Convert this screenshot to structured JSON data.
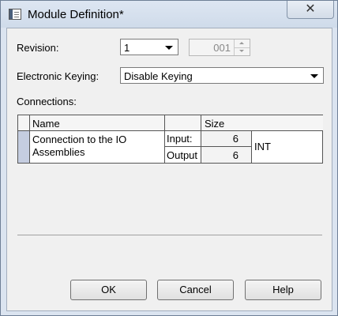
{
  "window": {
    "title": "Module Definition*",
    "close_icon": "✕"
  },
  "form": {
    "revision_label": "Revision:",
    "revision_major": "1",
    "revision_minor": "001",
    "keying_label": "Electronic Keying:",
    "keying_value": "Disable Keying",
    "connections_label": "Connections:"
  },
  "connections": {
    "columns": {
      "name": "Name",
      "size": "Size"
    },
    "rows": [
      {
        "name": "Connection to the IO Assemblies",
        "input_label": "Input:",
        "input_size": "6",
        "output_label": "Output",
        "output_size": "6",
        "type": "INT"
      }
    ]
  },
  "buttons": {
    "ok": "OK",
    "cancel": "Cancel",
    "help": "Help"
  },
  "colors": {
    "row_selector": "#c5cde0",
    "window_bg": "#dbe4f0"
  }
}
